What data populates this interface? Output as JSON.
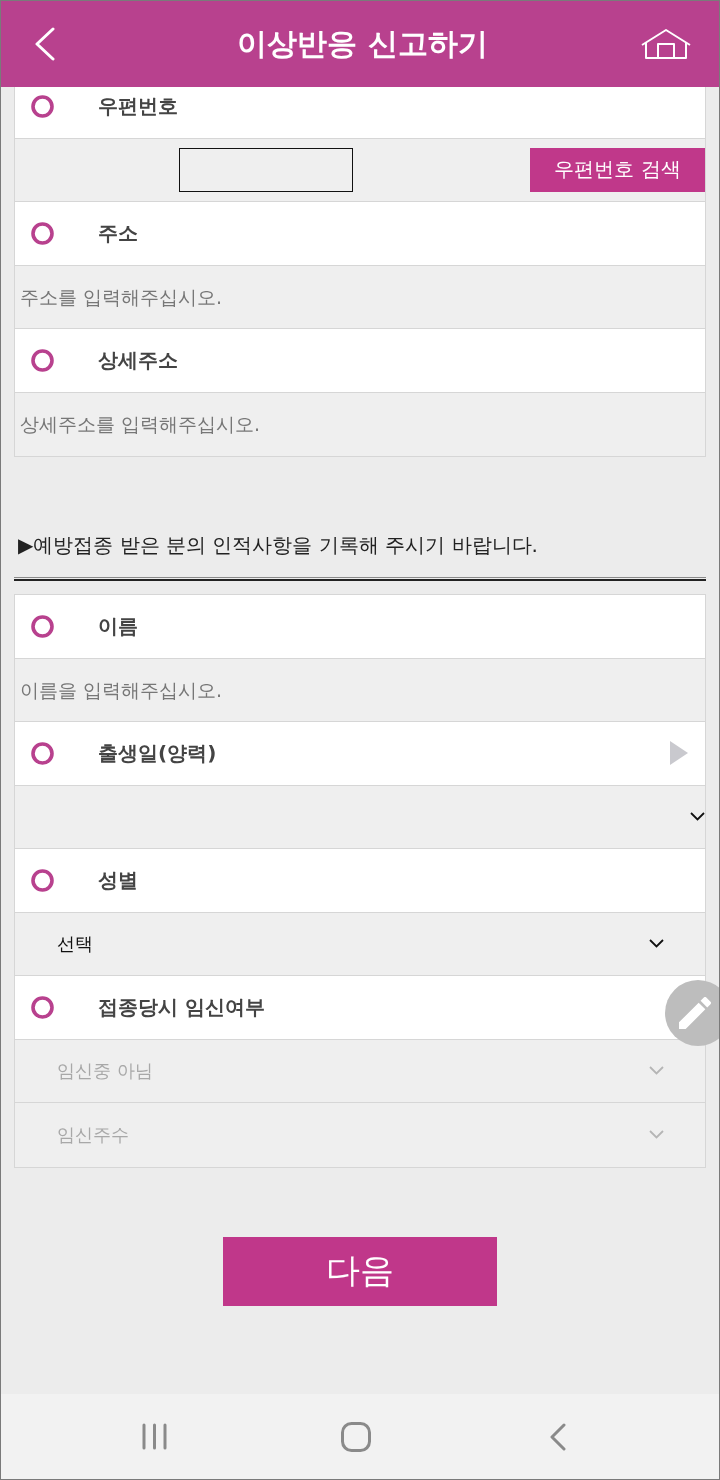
{
  "header": {
    "title": "이상반응 신고하기"
  },
  "sections": [
    {
      "fields": [
        {
          "label": "우편번호",
          "controls": [
            {
              "kind": "postcode",
              "button": "우편번호 검색"
            }
          ]
        },
        {
          "label": "주소",
          "controls": [
            {
              "kind": "text",
              "placeholder": "주소를 입력해주십시오."
            }
          ]
        },
        {
          "label": "상세주소",
          "controls": [
            {
              "kind": "text",
              "placeholder": "상세주소를 입력해주십시오."
            }
          ]
        }
      ]
    },
    {
      "notice": "▶예방접종 받은 분의 인적사항을 기록해 주시기 바랍니다.",
      "fields": [
        {
          "label": "이름",
          "controls": [
            {
              "kind": "text",
              "placeholder": "이름을 입력해주십시오."
            }
          ]
        },
        {
          "label": "출생일(양력)",
          "controls": [
            {
              "kind": "date",
              "disabled": false
            }
          ]
        },
        {
          "label": "성별",
          "controls": [
            {
              "kind": "select",
              "value": "선택",
              "disabled": false
            }
          ]
        },
        {
          "label": "접종당시 임신여부",
          "controls": [
            {
              "kind": "select",
              "value": "임신중 아님",
              "disabled": true
            },
            {
              "kind": "select",
              "value": "임신주수",
              "disabled": true
            }
          ]
        }
      ]
    }
  ],
  "next_button": "다음"
}
